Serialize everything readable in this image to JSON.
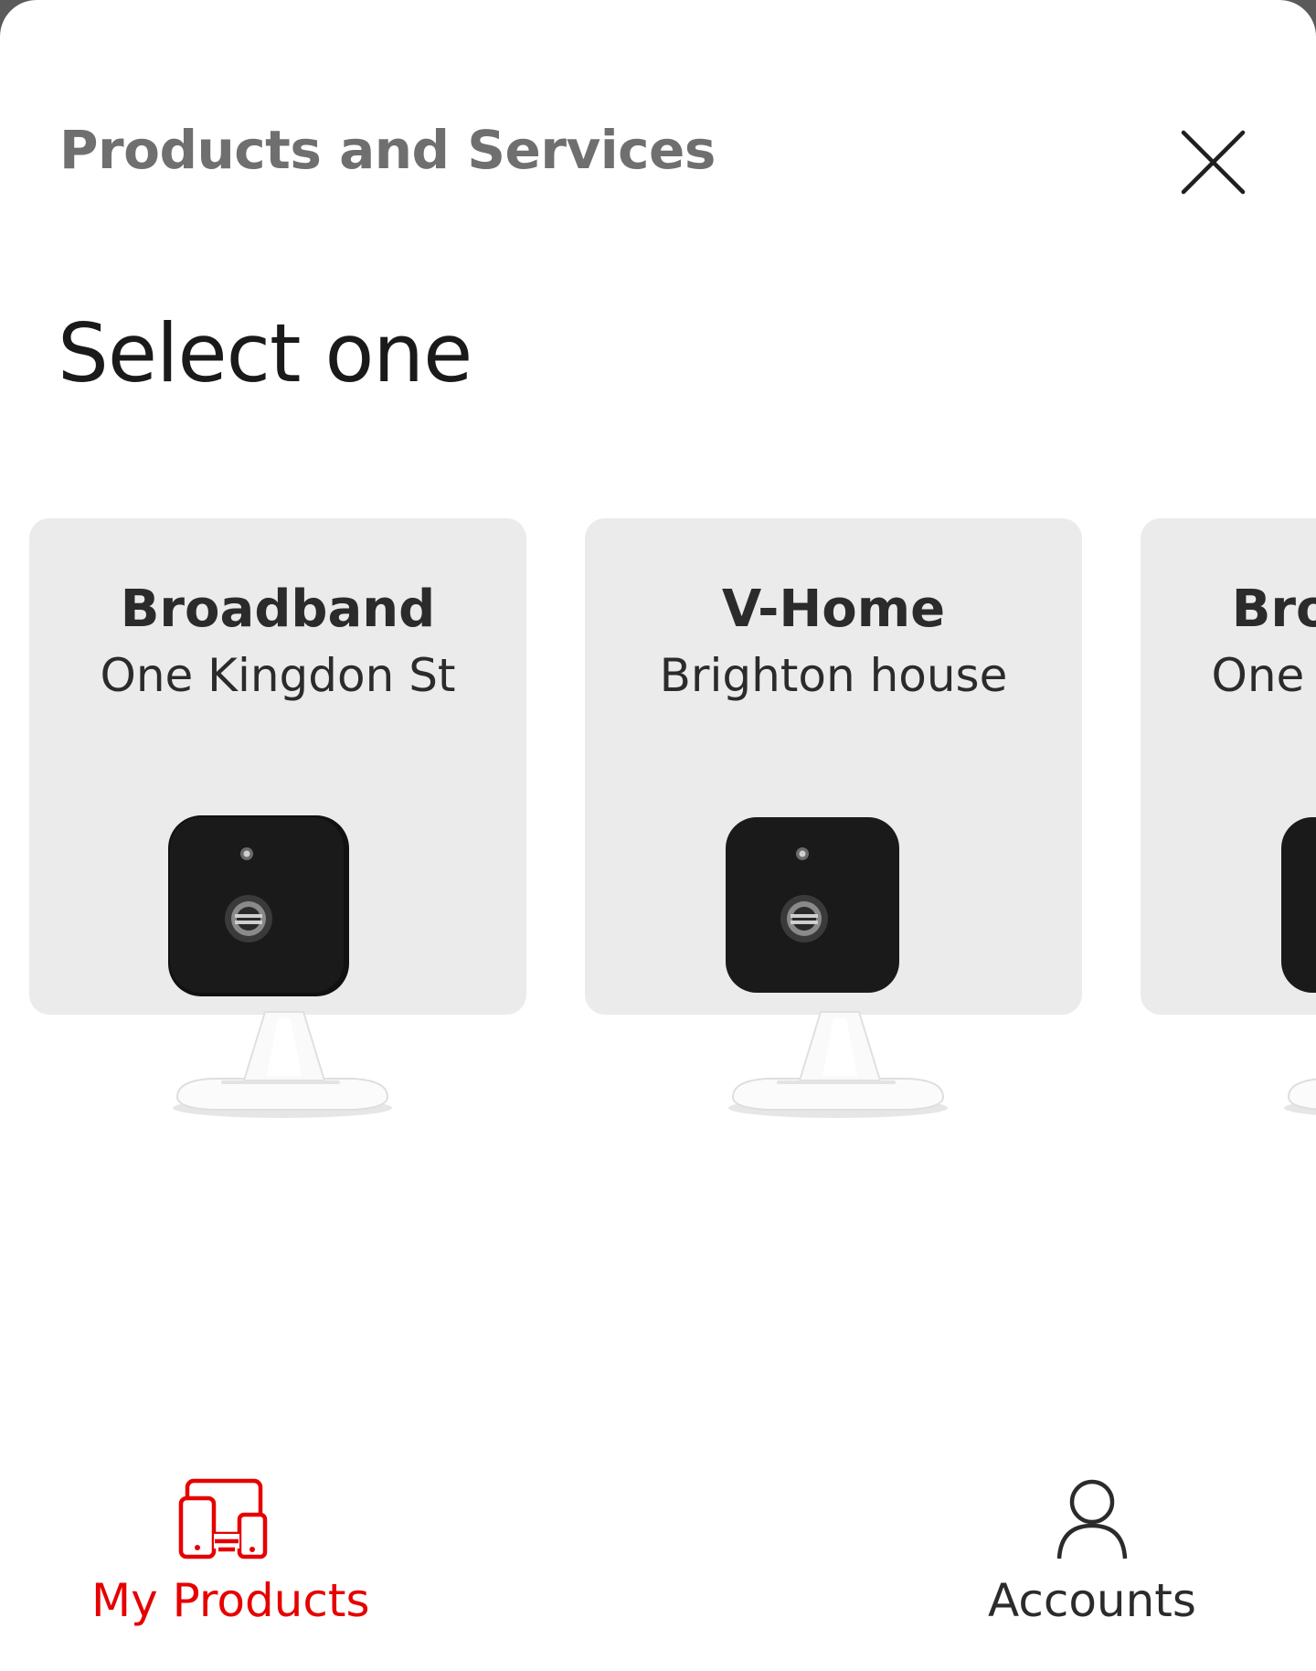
{
  "header": {
    "title": "Products and Services",
    "close_icon": "close-icon"
  },
  "section": {
    "title": "Select one"
  },
  "cards": [
    {
      "title": "Broadband",
      "subtitle": "One Kingdon St",
      "image": "security-camera-image"
    },
    {
      "title": "V-Home",
      "subtitle": "Brighton house",
      "image": "security-camera-image"
    },
    {
      "title": "Broadband",
      "subtitle": "One Kingdon St",
      "image": "security-camera-image"
    }
  ],
  "bottom_nav": {
    "items": [
      {
        "label": "My Products",
        "icon": "devices-icon",
        "active": true
      },
      {
        "label": "Accounts",
        "icon": "person-icon",
        "active": false
      }
    ]
  },
  "colors": {
    "accent": "#e60000",
    "card_background": "#ebebeb",
    "header_text": "#6f6f6f"
  }
}
